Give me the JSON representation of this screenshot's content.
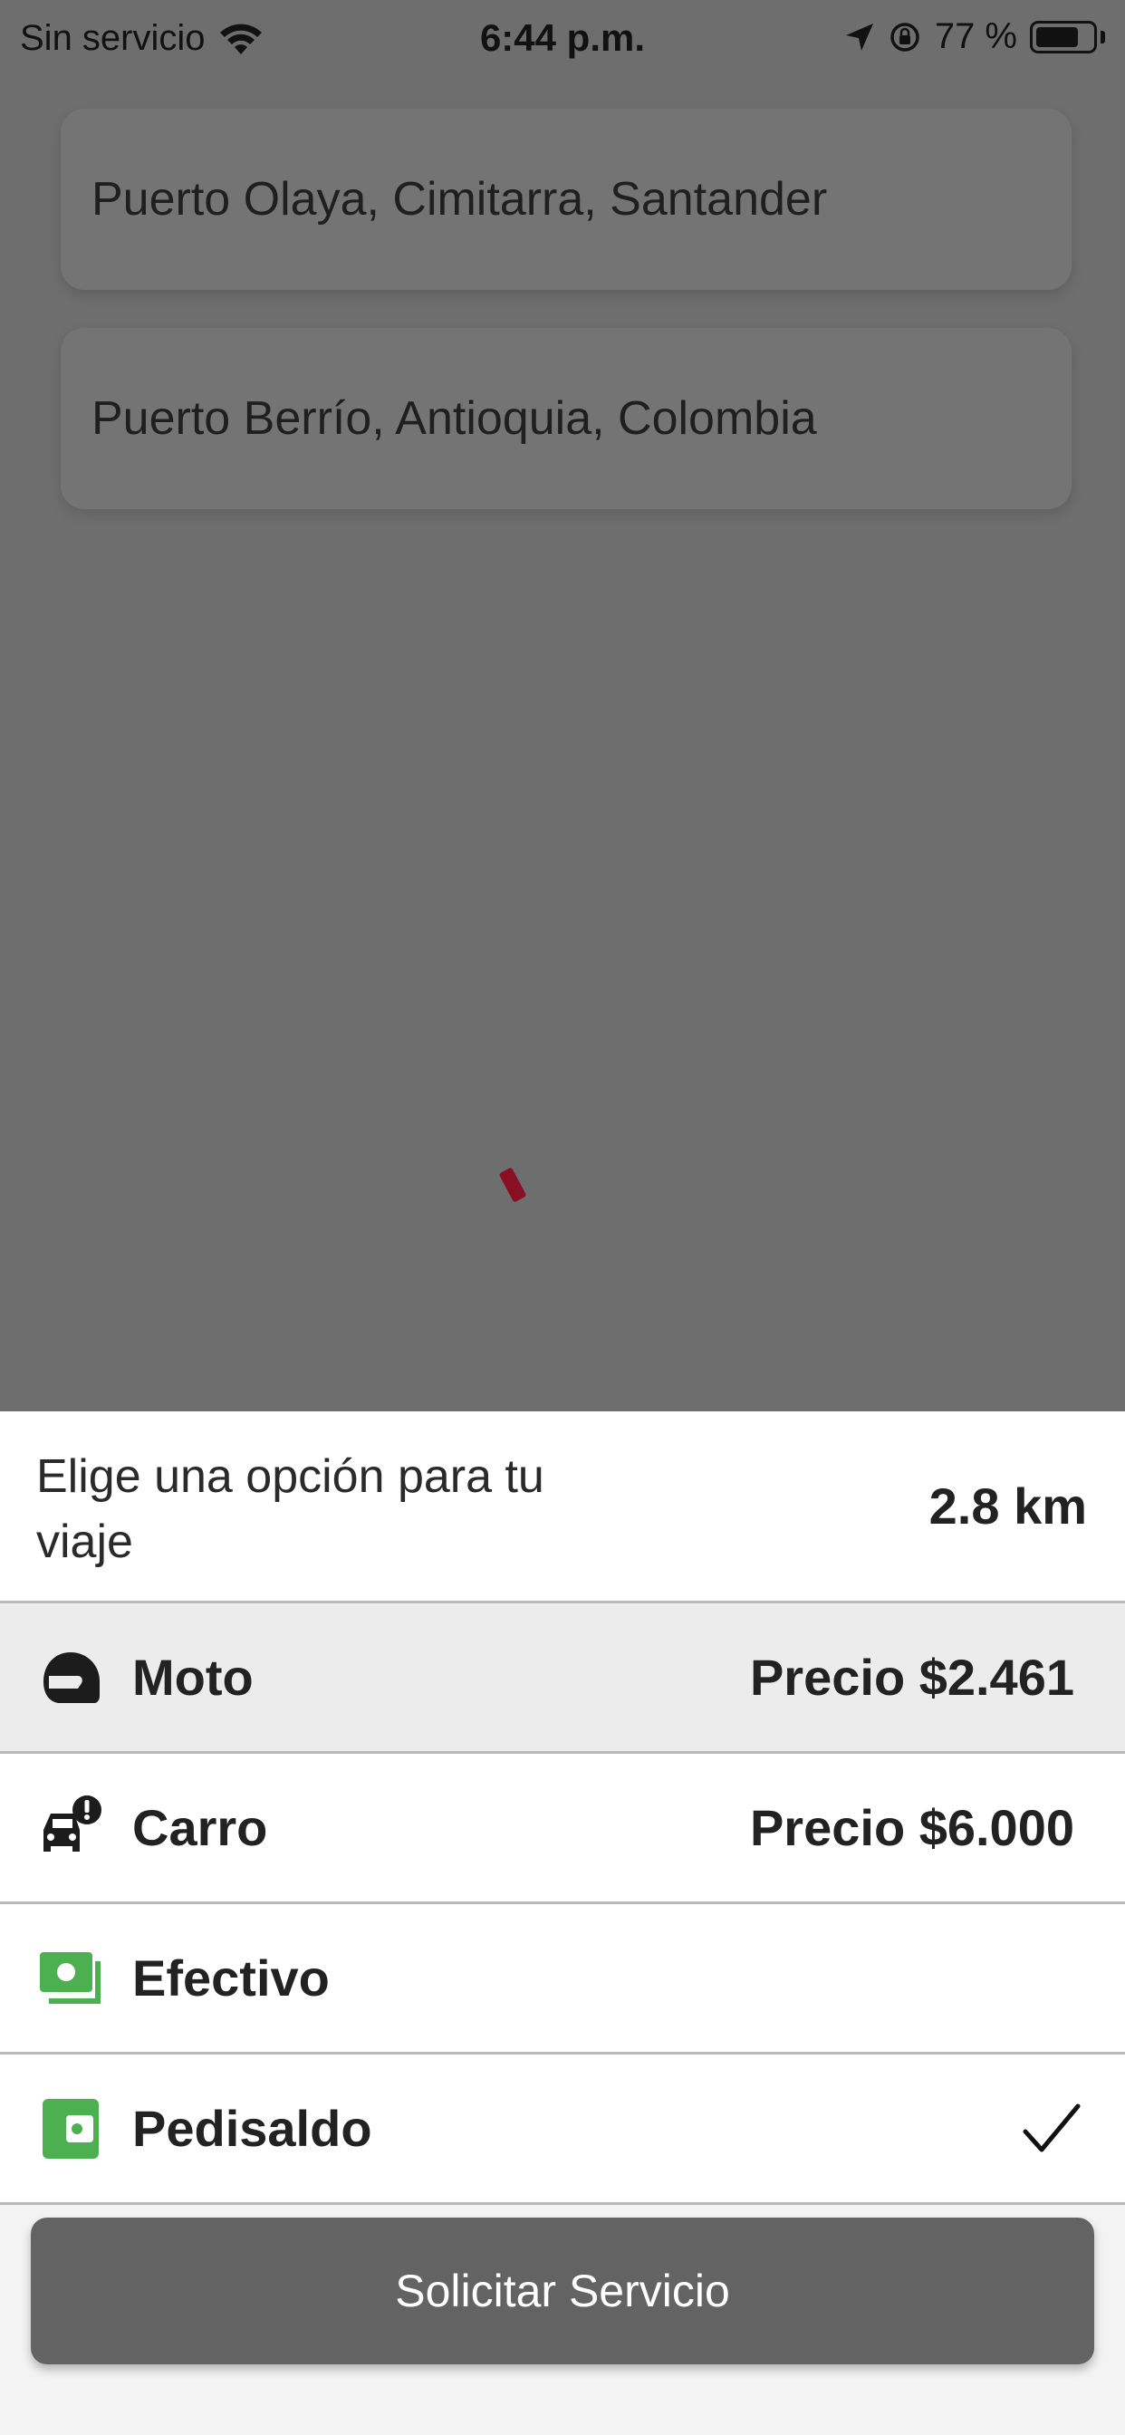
{
  "status_bar": {
    "carrier": "Sin servicio",
    "time": "6:44 p.m.",
    "battery_percent": "77 %",
    "battery_level": 0.77
  },
  "route": {
    "origin": "Puerto Olaya, Cimitarra, Santander",
    "destination": "Puerto Berrío, Antioquia, Colombia"
  },
  "sheet": {
    "title": "Elige una opción para tu viaje",
    "distance": "2.8 km"
  },
  "options": [
    {
      "label": "Moto",
      "price": "Precio $2.461",
      "icon": "motorcycle-helmet-icon",
      "selected": true
    },
    {
      "label": "Carro",
      "price": "Precio $6.000",
      "icon": "car-alert-icon",
      "selected": false
    }
  ],
  "payments": [
    {
      "label": "Efectivo",
      "icon": "cash-icon",
      "checked": false
    },
    {
      "label": "Pedisaldo",
      "icon": "wallet-icon",
      "checked": true
    }
  ],
  "request_button_label": "Solicitar Servicio",
  "colors": {
    "payment_icon_green": "#4caf50",
    "map_marker": "#8a0f24",
    "button_bg": "#636363"
  }
}
